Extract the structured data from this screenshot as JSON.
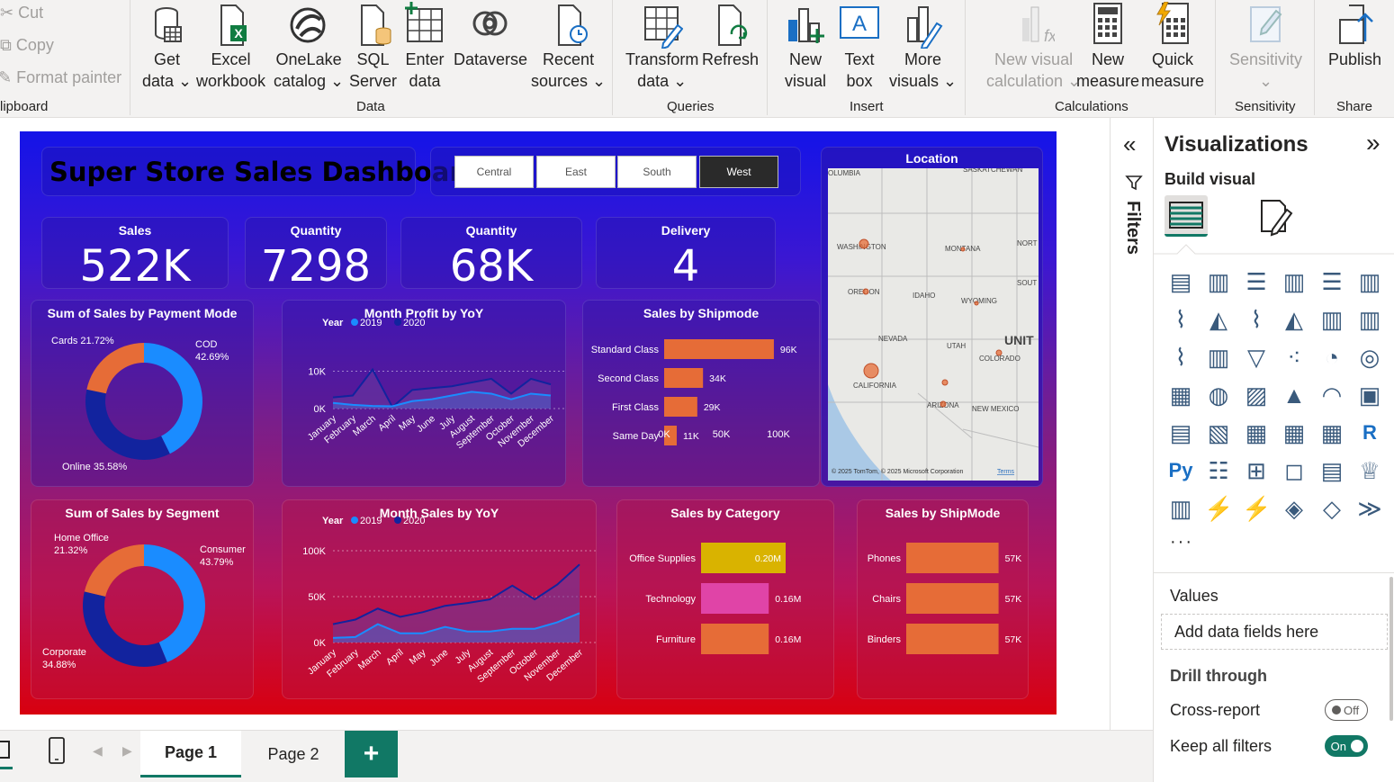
{
  "ribbon": {
    "clipboard": {
      "cut": "Cut",
      "copy": "Copy",
      "format_painter": "Format painter",
      "group": "lipboard"
    },
    "data_group": "Data",
    "queries_group": "Queries",
    "insert_group": "Insert",
    "calculations_group": "Calculations",
    "sensitivity_group": "Sensitivity",
    "share_group": "Share",
    "buttons": {
      "get_data": [
        "Get",
        "data ⌄"
      ],
      "excel": [
        "Excel",
        "workbook"
      ],
      "onelake": [
        "OneLake",
        "catalog ⌄"
      ],
      "sql": [
        "SQL",
        "Server"
      ],
      "enter": [
        "Enter",
        "data"
      ],
      "dataverse": [
        "Dataverse",
        ""
      ],
      "recent": [
        "Recent",
        "sources ⌄"
      ],
      "transform": [
        "Transform",
        "data ⌄"
      ],
      "refresh": [
        "Refresh",
        ""
      ],
      "new_visual": [
        "New",
        "visual"
      ],
      "text_box": [
        "Text",
        "box"
      ],
      "more_visuals": [
        "More",
        "visuals ⌄"
      ],
      "new_visual_calc": [
        "New visual",
        "calculation ⌄"
      ],
      "new_measure": [
        "New",
        "measure"
      ],
      "quick_measure": [
        "Quick",
        "measure"
      ],
      "sensitivity": [
        "Sensitivity",
        "⌄"
      ],
      "publish": [
        "Publish",
        ""
      ]
    }
  },
  "dashboard": {
    "title": "Super Store Sales Dashboard",
    "regions": [
      "Central",
      "East",
      "South",
      "West"
    ],
    "selected_region": "West",
    "kpis": [
      {
        "label": "Sales",
        "value": "522K"
      },
      {
        "label": "Quantity",
        "value": "7298"
      },
      {
        "label": "Quantity",
        "value": "68K"
      },
      {
        "label": "Delivery",
        "value": "4"
      }
    ],
    "location_title": "Location",
    "map_labels": [
      "OLUMBIA",
      "SASKATCHEWAN",
      "WASHINGTON",
      "MONTANA",
      "NORT",
      "OREGON",
      "IDAHO",
      "WYOMING",
      "SOUT",
      "NEVADA",
      "UTAH",
      "UNIT",
      "COLORADO",
      "CALIFORNIA",
      "ARIZONA",
      "NEW MEXICO"
    ],
    "map_credit": "© 2025 TomTom, © 2025 Microsoft Corporation",
    "map_terms": "Terms",
    "year_label": "Year",
    "year_2019": "2019",
    "year_2020": "2020",
    "months": [
      "January",
      "February",
      "March",
      "April",
      "May",
      "June",
      "July",
      "August",
      "September",
      "October",
      "November",
      "December"
    ]
  },
  "chart_data": [
    {
      "type": "pie",
      "title": "Sum of Sales by Payment Mode",
      "categories": [
        "COD",
        "Online",
        "Cards"
      ],
      "values": [
        42.69,
        35.58,
        21.72
      ],
      "labels": [
        "COD\n42.69%",
        "Online 35.58%",
        "Cards 21.72%"
      ],
      "colors": [
        "#1a8cff",
        "#12239e",
        "#e66c37"
      ]
    },
    {
      "type": "area",
      "title": "Month Profit by YoY",
      "x": [
        "January",
        "February",
        "March",
        "April",
        "May",
        "June",
        "July",
        "August",
        "September",
        "October",
        "November",
        "December"
      ],
      "series": [
        {
          "name": "2019",
          "values": [
            1500,
            1000,
            700,
            600,
            2000,
            2500,
            3500,
            4500,
            4000,
            2500,
            4000,
            3500
          ]
        },
        {
          "name": "2020",
          "values": [
            3000,
            3500,
            10500,
            400,
            5000,
            5500,
            6000,
            7000,
            8000,
            4000,
            8000,
            6500
          ]
        }
      ],
      "yticks": [
        "10K",
        "0K"
      ],
      "ylim": [
        0,
        15000
      ]
    },
    {
      "type": "bar",
      "title": "Sales by Shipmode",
      "categories": [
        "Standard Class",
        "Second Class",
        "First Class",
        "Same Day"
      ],
      "values": [
        96,
        34,
        29,
        11
      ],
      "value_labels": [
        "96K",
        "34K",
        "29K",
        "11K"
      ],
      "xticks": [
        "0K",
        "50K",
        "100K"
      ],
      "xlim": [
        0,
        100
      ]
    },
    {
      "type": "pie",
      "title": "Sum of Sales by Segment",
      "categories": [
        "Consumer",
        "Corporate",
        "Home Office"
      ],
      "values": [
        43.79,
        34.88,
        21.32
      ],
      "labels": [
        "Consumer\n43.79%",
        "Corporate\n34.88%",
        "Home Office\n21.32%"
      ],
      "colors": [
        "#1a8cff",
        "#12239e",
        "#e66c37"
      ]
    },
    {
      "type": "area",
      "title": "Month Sales by YoY",
      "x": [
        "January",
        "February",
        "March",
        "April",
        "May",
        "June",
        "July",
        "August",
        "September",
        "October",
        "November",
        "December"
      ],
      "series": [
        {
          "name": "2019",
          "values": [
            5000,
            6000,
            20000,
            10000,
            10000,
            17000,
            12000,
            12000,
            15000,
            15000,
            22000,
            32000
          ]
        },
        {
          "name": "2020",
          "values": [
            20000,
            25000,
            37000,
            28000,
            33000,
            40000,
            43000,
            47000,
            62000,
            47000,
            63000,
            85000
          ]
        }
      ],
      "yticks": [
        "100K",
        "50K",
        "0K"
      ],
      "ylim": [
        0,
        100000
      ]
    },
    {
      "type": "bar",
      "title": "Sales by Category",
      "categories": [
        "Office Supplies",
        "Technology",
        "Furniture"
      ],
      "values": [
        0.2,
        0.16,
        0.16
      ],
      "value_labels": [
        "0.20M",
        "0.16M",
        "0.16M"
      ],
      "xticks": [
        "0.0M",
        "0.1M",
        "0.2M"
      ],
      "xlim": [
        0,
        0.2
      ],
      "colors": [
        "#d9b300",
        "#e044a7",
        "#e66c37"
      ]
    },
    {
      "type": "bar",
      "title": "Sales by ShipMode",
      "categories": [
        "Phones",
        "Chairs",
        "Binders"
      ],
      "values": [
        57,
        57,
        57
      ],
      "value_labels": [
        "57K",
        "57K",
        "57K"
      ],
      "xticks": [
        "0K",
        "50K"
      ],
      "xlim": [
        0,
        60
      ]
    }
  ],
  "filters_label": "Filters",
  "visualizations": {
    "title": "Visualizations",
    "build_visual": "Build visual",
    "values_label": "Values",
    "add_fields": "Add data fields here",
    "drill_through": "Drill through",
    "cross_report": "Cross-report",
    "cross_report_state": "Off",
    "keep_filters": "Keep all filters",
    "keep_filters_state": "On",
    "more": "···"
  },
  "pages": {
    "page1": "Page 1",
    "page2": "Page 2",
    "add": "+"
  },
  "colors": {
    "accent": "#117865",
    "blue": "#1a8cff",
    "navy": "#12239e",
    "orange": "#e66c37"
  }
}
